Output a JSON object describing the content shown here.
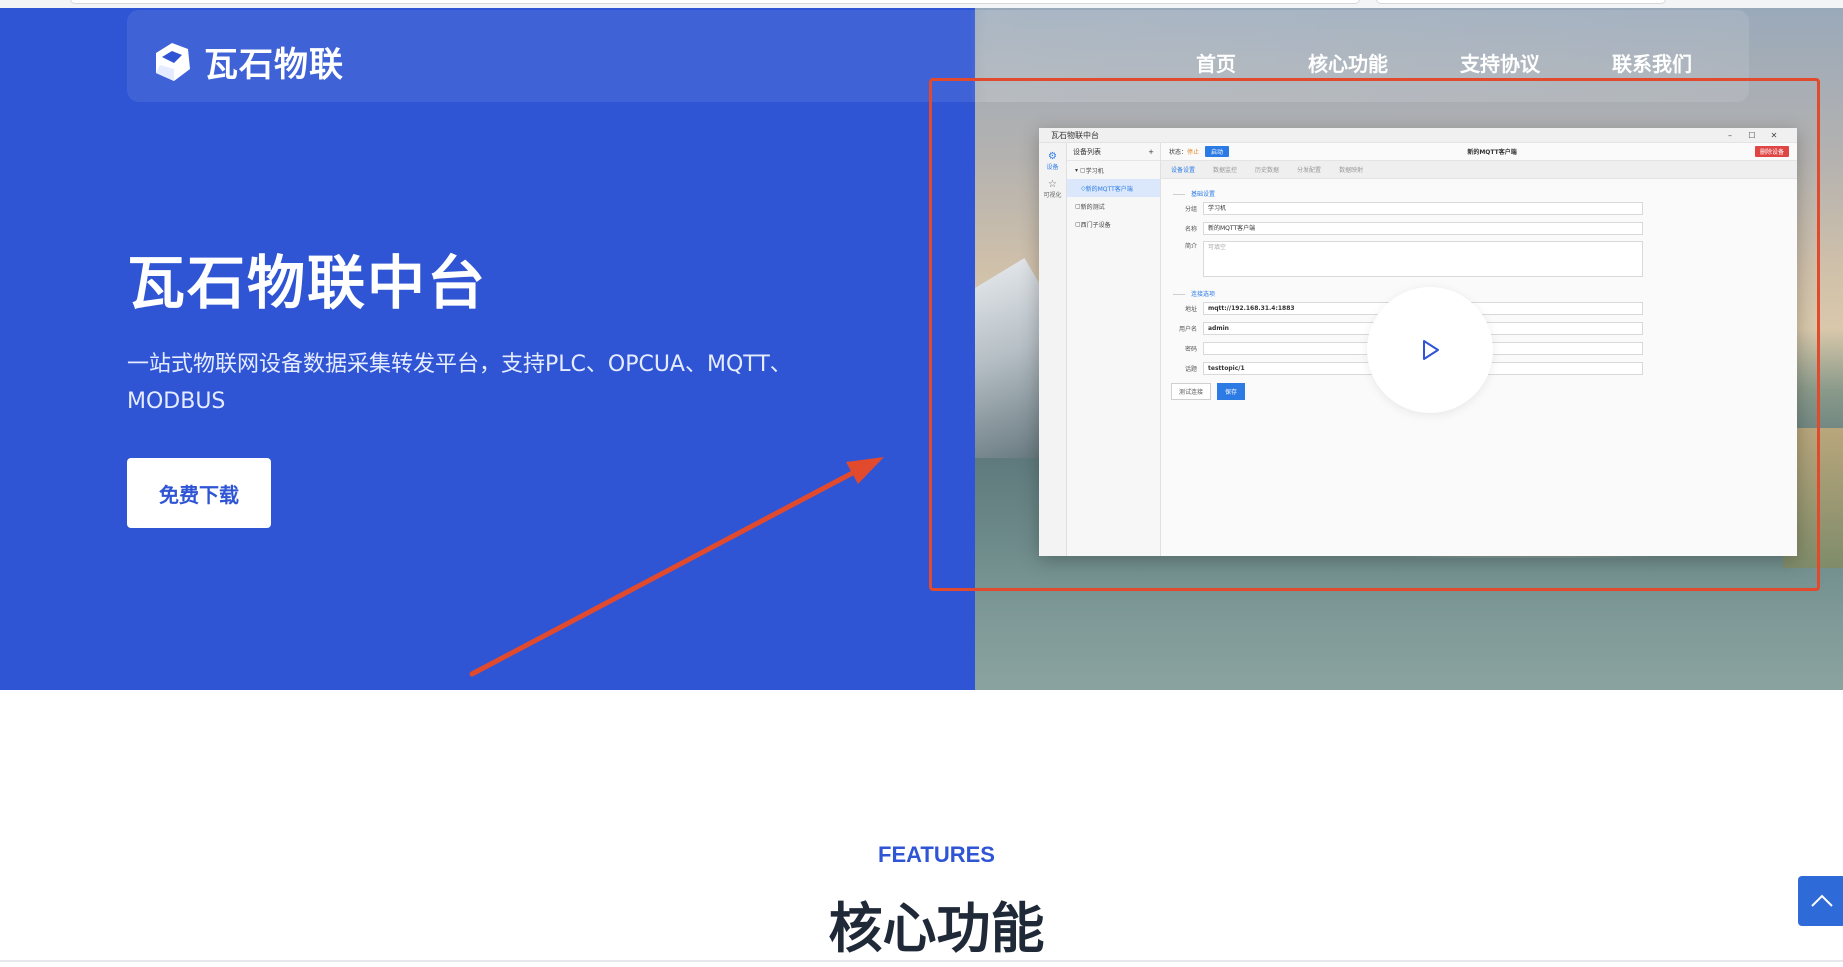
{
  "brand": {
    "name": "瓦石物联",
    "blue": "#2f55d4"
  },
  "nav": {
    "items": [
      "首页",
      "核心功能",
      "支持协议",
      "联系我们"
    ]
  },
  "hero": {
    "title": "瓦石物联中台",
    "subtitle": "一站式物联网设备数据采集转发平台，支持PLC、OPCUA、MQTT、MODBUS",
    "download_label": "免费下载"
  },
  "app_window": {
    "title": "瓦石物联中台",
    "controls": [
      "–",
      "☐",
      "✕"
    ],
    "rail": [
      {
        "icon": "gear-icon",
        "label": "设备"
      },
      {
        "icon": "star-icon",
        "label": "可视化"
      }
    ],
    "tree": {
      "header": "设备列表",
      "add": "+",
      "nodes": [
        "学习机",
        "新的MQTT客户端",
        "新的测试",
        "西门子设备"
      ]
    },
    "toolbar": {
      "status_label": "状态：",
      "status_value": "停止",
      "start_label": "启动",
      "device_name": "新的MQTT客户端",
      "delete_label": "删除设备"
    },
    "tabs": [
      "设备设置",
      "数据监控",
      "历史数据",
      "分发配置",
      "数据映射"
    ],
    "sections": {
      "basic": "基础设置",
      "connection": "连接选项"
    },
    "fields": [
      {
        "label": "分组",
        "value": "学习机"
      },
      {
        "label": "名称",
        "value": "新的MQTT客户端"
      },
      {
        "label": "简介",
        "value": "可填空"
      },
      {
        "label": "地址",
        "value": "mqtt://192.168.31.4:1883"
      },
      {
        "label": "用户名",
        "value": "admin"
      },
      {
        "label": "密码",
        "value": ""
      },
      {
        "label": "话题",
        "value": "testtopic/1"
      }
    ],
    "buttons": {
      "test": "测试连接",
      "save": "保存"
    }
  },
  "features": {
    "eyebrow": "FEATURES",
    "title": "核心功能"
  },
  "annotation": {
    "color": "#e24a2e"
  }
}
